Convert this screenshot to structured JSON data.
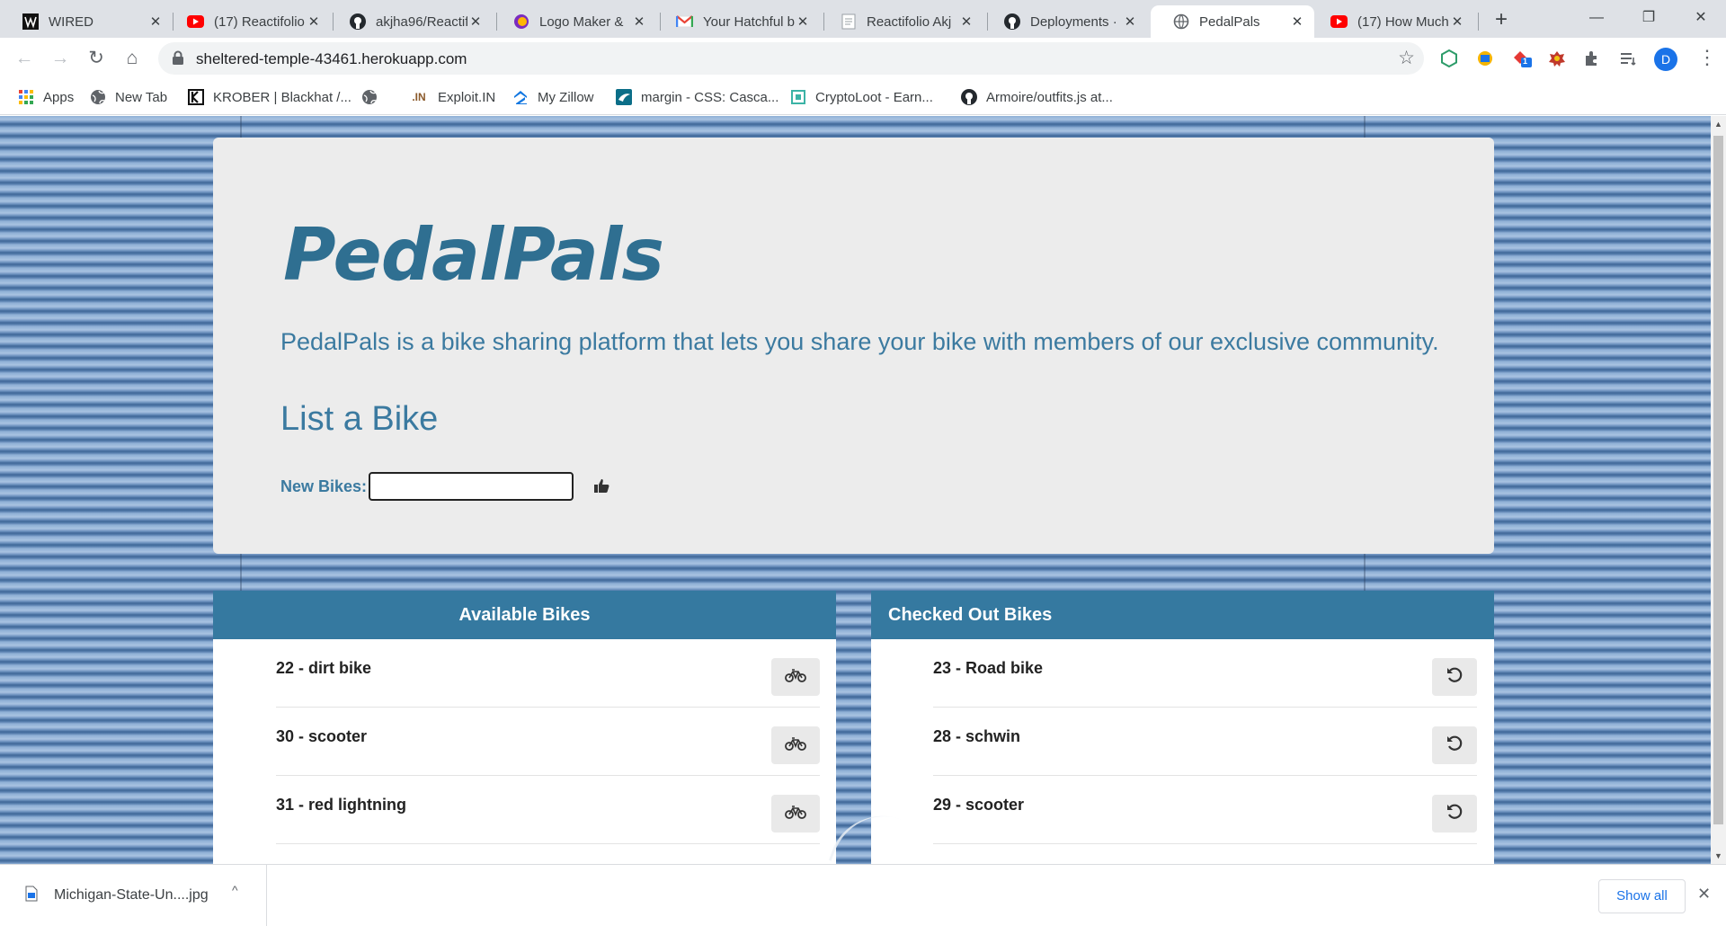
{
  "tabs": [
    {
      "title": "WIRED",
      "icon": "wired-icon",
      "active": false
    },
    {
      "title": "(17) Reactifolio",
      "icon": "youtube-icon",
      "active": false
    },
    {
      "title": "akjha96/Reactif",
      "icon": "github-icon",
      "active": false
    },
    {
      "title": "Logo Maker & ",
      "icon": "logo-maker-icon",
      "active": false
    },
    {
      "title": "Your Hatchful b",
      "icon": "gmail-icon",
      "active": false
    },
    {
      "title": "Reactifolio Akj",
      "icon": "document-icon",
      "active": false
    },
    {
      "title": "Deployments ·",
      "icon": "github-icon",
      "active": false
    },
    {
      "title": "PedalPals",
      "icon": "globe-icon",
      "active": true
    },
    {
      "title": "(17) How Much",
      "icon": "youtube-icon",
      "active": false
    }
  ],
  "tab_close": "✕",
  "new_tab": "+",
  "window": {
    "minimize": "—",
    "maximize": "❐",
    "close": "✕"
  },
  "toolbar": {
    "back": "←",
    "forward": "→",
    "reload": "↻",
    "home": "⌂"
  },
  "omnibox": {
    "url": "sheltered-temple-43461.herokuapp.com",
    "star": "☆"
  },
  "extension_badge": "1",
  "profile_initial": "D",
  "menu": "⋮",
  "bookmarks": [
    {
      "label": "Apps",
      "icon": "apps-grid-icon"
    },
    {
      "label": "New Tab",
      "icon": "globe-icon"
    },
    {
      "label": "KROBER | Blackhat /...",
      "icon": "krober-icon"
    },
    {
      "label": "",
      "icon": "globe-icon"
    },
    {
      "label": "Exploit.IN",
      "icon": "exploit-in-icon"
    },
    {
      "label": "My Zillow",
      "icon": "zillow-icon"
    },
    {
      "label": "margin - CSS: Casca...",
      "icon": "stackoverflow-icon"
    },
    {
      "label": "CryptoLoot - Earn...",
      "icon": "cryptoloot-icon"
    },
    {
      "label": "Armoire/outfits.js at...",
      "icon": "github-icon"
    }
  ],
  "page": {
    "brand": "PedalPals",
    "tagline": "PedalPals is a bike sharing platform that lets you share your bike with members of our exclusive community.",
    "list_heading": "List a Bike",
    "new_bikes_label": "New Bikes:",
    "new_bikes_value": "",
    "submit_icon": "thumbs-up-icon"
  },
  "available": {
    "heading": "Available Bikes",
    "action_icon": "bicycle-icon",
    "items": [
      "22 - dirt bike",
      "30 - scooter",
      "31 - red lightning"
    ]
  },
  "checked_out": {
    "heading": "Checked Out Bikes",
    "action_icon": "undo-icon",
    "items": [
      "23 - Road bike",
      "28 - schwin",
      "29 - scooter"
    ]
  },
  "download": {
    "filename": "Michigan-State-Un....jpg",
    "show_all": "Show all",
    "close": "✕",
    "caret": "^"
  },
  "colors": {
    "brand": "#2f6f91",
    "accent": "#3579a0",
    "text_blue": "#3b7aa0"
  }
}
